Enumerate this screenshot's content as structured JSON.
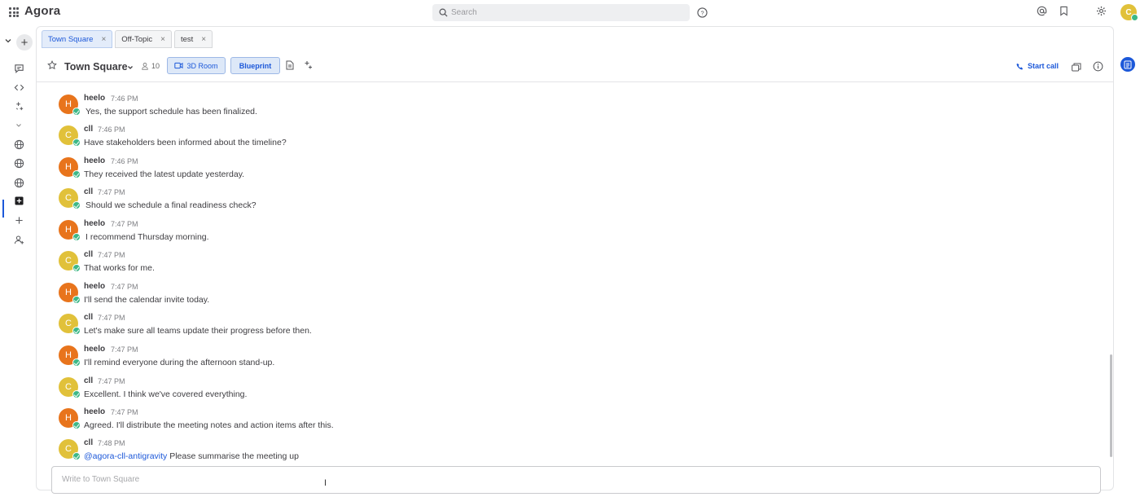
{
  "app": {
    "title": "Agora"
  },
  "search": {
    "placeholder": "Search"
  },
  "tabs": [
    {
      "label": "Town Square",
      "active": true
    },
    {
      "label": "Off-Topic",
      "active": false
    },
    {
      "label": "test",
      "active": false
    }
  ],
  "channel": {
    "name": "Town Square",
    "member_count": "10",
    "room_button": "3D Room",
    "blueprint_button": "Blueprint",
    "start_call": "Start call"
  },
  "messages": [
    {
      "author": "heelo",
      "initial": "H",
      "time": "7:46 PM",
      "text": "Yes, the support schedule has been finalized.",
      "avatar_color": "#e8741c"
    },
    {
      "author": "cll",
      "initial": "C",
      "time": "7:46 PM",
      "text": "Have stakeholders been informed about the timeline?",
      "avatar_color": "#e1c13a"
    },
    {
      "author": "heelo",
      "initial": "H",
      "time": "7:46 PM",
      "text": "They received the latest update yesterday.",
      "avatar_color": "#e8741c"
    },
    {
      "author": "cll",
      "initial": "C",
      "time": "7:47 PM",
      "text": "Should we schedule a final readiness check?",
      "avatar_color": "#e1c13a"
    },
    {
      "author": "heelo",
      "initial": "H",
      "time": "7:47 PM",
      "text": "I recommend Thursday morning.",
      "avatar_color": "#e8741c"
    },
    {
      "author": "cll",
      "initial": "C",
      "time": "7:47 PM",
      "text": "That works for me.",
      "avatar_color": "#e1c13a"
    },
    {
      "author": "heelo",
      "initial": "H",
      "time": "7:47 PM",
      "text": "I'll send the calendar invite today.",
      "avatar_color": "#e8741c"
    },
    {
      "author": "cll",
      "initial": "C",
      "time": "7:47 PM",
      "text": "Let's make sure all teams update their progress before then.",
      "avatar_color": "#e1c13a"
    },
    {
      "author": "heelo",
      "initial": "H",
      "time": "7:47 PM",
      "text": "I'll remind everyone during the afternoon stand-up.",
      "avatar_color": "#e8741c"
    },
    {
      "author": "cll",
      "initial": "C",
      "time": "7:47 PM",
      "text": "Excellent. I think we've covered everything.",
      "avatar_color": "#e1c13a"
    },
    {
      "author": "heelo",
      "initial": "H",
      "time": "7:47 PM",
      "text": "Agreed. I'll distribute the meeting notes and action items after this.",
      "avatar_color": "#e8741c"
    },
    {
      "author": "cll",
      "initial": "C",
      "time": "7:48 PM",
      "mention": "@agora-cll-antigravity",
      "text": " Please summarise the meeting up",
      "avatar_color": "#e1c13a"
    }
  ],
  "composer": {
    "placeholder": "Write to Town Square"
  },
  "user_avatar": {
    "initial": "C",
    "color": "#e1c13a"
  },
  "colors": {
    "accent": "#1c58d9",
    "online": "#3db887"
  }
}
